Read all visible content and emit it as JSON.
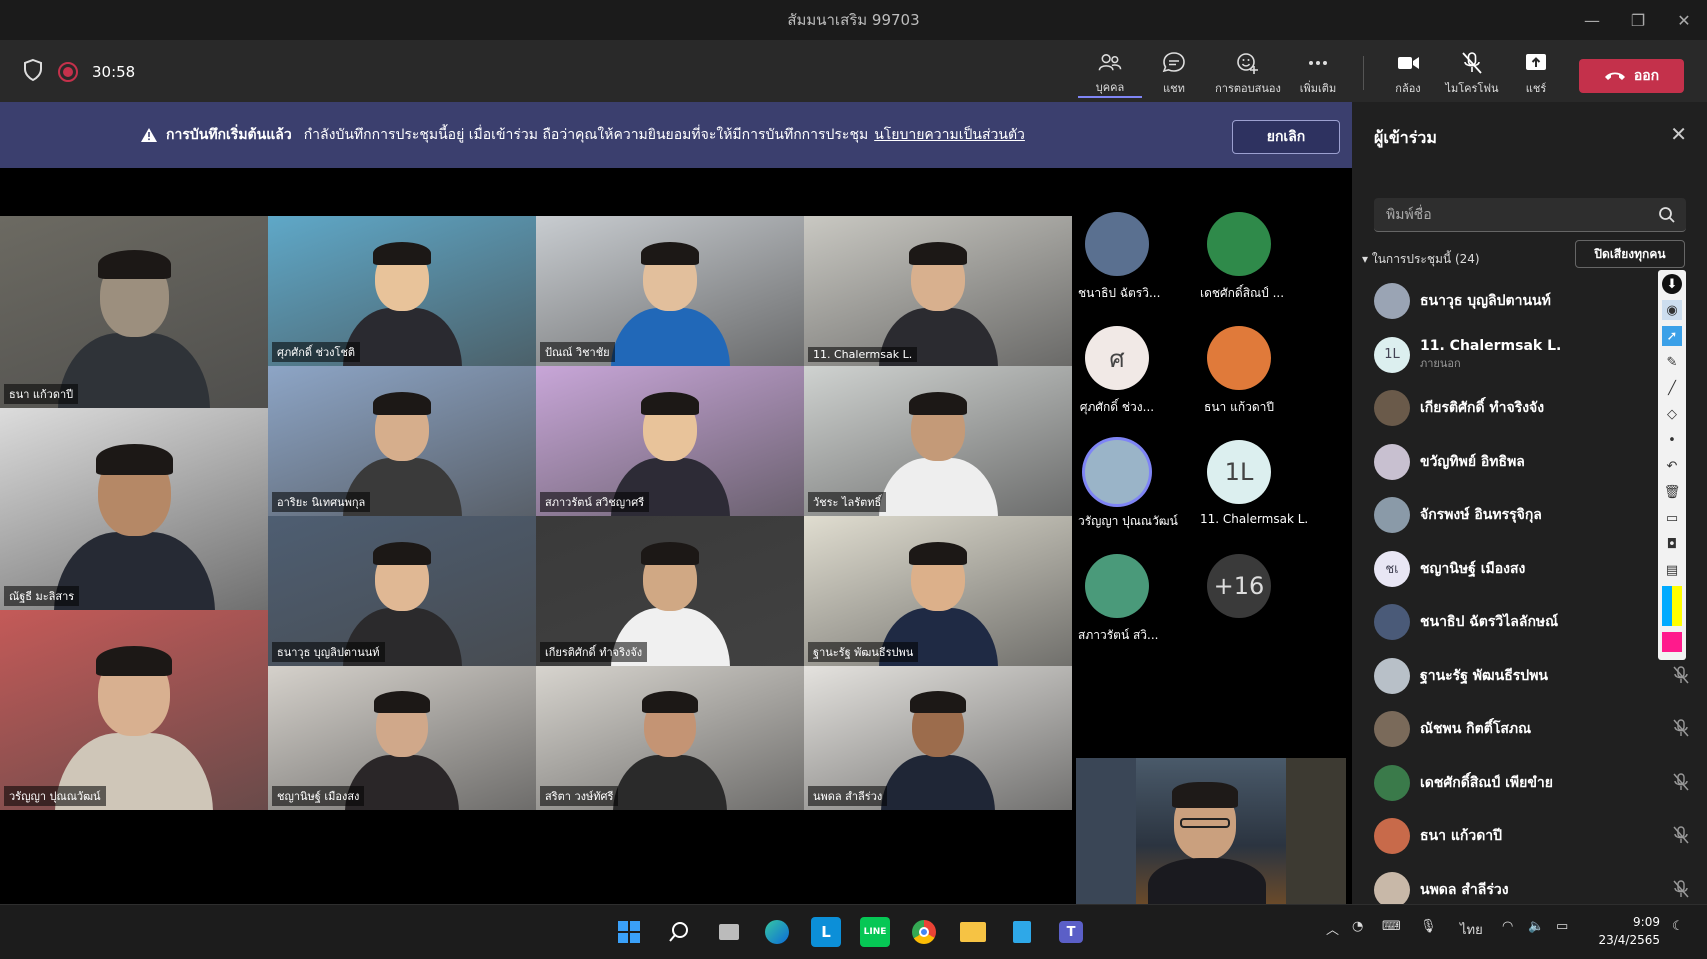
{
  "window": {
    "title": "สัมมนาเสริม 99703",
    "minimize": "—",
    "restore": "❐",
    "close": "✕"
  },
  "toolbar": {
    "timer": "30:58",
    "people_label": "บุคคล",
    "chat_label": "แชท",
    "reactions_label": "การตอบสนอง",
    "more_label": "เพิ่มเติม",
    "camera_label": "กล้อง",
    "mic_label": "ไมโครโฟน",
    "share_label": "แชร์",
    "leave_label": "ออก"
  },
  "banner": {
    "title": "การบันทึกเริ่มต้นแล้ว",
    "message": "กำลังบันทึกการประชุมนี้อยู่ เมื่อเข้าร่วม ถือว่าคุณให้ความยินยอมที่จะให้มีการบันทึกการประชุม",
    "link": "นโยบายความเป็นส่วนตัว",
    "cancel": "ยกเลิก"
  },
  "video_tiles": [
    {
      "name": "ธนา แก้วดาปี"
    },
    {
      "name": "ศุภศักดิ์ ช่วงโชติ"
    },
    {
      "name": "ปัณณ์ วิชาชัย"
    },
    {
      "name": "11. Chalermsak L."
    },
    {
      "name": "ณัฐธี มะลิสาร"
    },
    {
      "name": "อาริยะ นิเทศนพกุล"
    },
    {
      "name": "สภาวรัตน์ สวิชญาศรี"
    },
    {
      "name": "วัชระ ไลรัตทธิ์"
    },
    {
      "name": "วรัญญา ปุณณวัฒน์"
    },
    {
      "name": "ธนาวุธ บุญลิปตานนท์"
    },
    {
      "name": "เกียรติศักดิ์ ทำจริงจัง"
    },
    {
      "name": "ฐานะรัฐ พัฒนธีรปพน"
    },
    {
      "name": "ชญานิษฐ์ เมืองสง"
    },
    {
      "name": "สริตา วงษ์ทัศรี"
    },
    {
      "name": "นพดล สำลีร่วง"
    }
  ],
  "roster_avatars": [
    {
      "name": "ชนาธิป ฉัตรวิ...",
      "initials": ""
    },
    {
      "name": "เดชศักดิ์สิณป์ ...",
      "initials": ""
    },
    {
      "name": "ศุภศักดิ์ ช่วง...",
      "initials": "ศ"
    },
    {
      "name": "ธนา แก้วดาปี",
      "initials": ""
    },
    {
      "name": "วรัญญา ปุณณวัฒน์",
      "initials": ""
    },
    {
      "name": "11. Chalermsak L.",
      "initials": "1L"
    },
    {
      "name": "สภาวรัตน์ สวิ...",
      "initials": ""
    },
    {
      "name": "",
      "initials": "+16"
    }
  ],
  "panel": {
    "title": "ผู้เข้าร่วม",
    "search_placeholder": "พิมพ์ชื่อ",
    "section": "ในการประชุมนี้ (24)",
    "mute_all": "ปิดเสียงทุกคน",
    "participants": [
      {
        "name": "ธนาวุธ บุญลิปตานนท์",
        "sub": "",
        "initials": "",
        "muted": false
      },
      {
        "name": "11. Chalermsak L.",
        "sub": "ภายนอก",
        "initials": "1L",
        "muted": false
      },
      {
        "name": "เกียรติศักดิ์ ทำจริงจัง",
        "sub": "",
        "initials": "",
        "muted": false
      },
      {
        "name": "ขวัญทิพย์ อิทธิพล",
        "sub": "",
        "initials": "",
        "muted": false
      },
      {
        "name": "จักรพงษ์ อินทรรุจิกุล",
        "sub": "",
        "initials": "",
        "muted": false
      },
      {
        "name": "ชญานิษฐ์ เมืองสง",
        "sub": "",
        "initials": "ชเ",
        "muted": false
      },
      {
        "name": "ชนาธิป ฉัตรวิไลลักษณ์",
        "sub": "",
        "initials": "",
        "muted": false
      },
      {
        "name": "ฐานะรัฐ พัฒนธีรปพน",
        "sub": "",
        "initials": "",
        "muted": true
      },
      {
        "name": "ณัชพน กิตติ์โสภณ",
        "sub": "",
        "initials": "",
        "muted": true
      },
      {
        "name": "เดชศักดิ์สิณป์ เพียขำย",
        "sub": "",
        "initials": "",
        "muted": true
      },
      {
        "name": "ธนา แก้วดาปี",
        "sub": "",
        "initials": "",
        "muted": true
      },
      {
        "name": "นพดล สำลีร่วง",
        "sub": "",
        "initials": "",
        "muted": true
      }
    ]
  },
  "taskbar": {
    "language": "ไทย",
    "time": "9:09",
    "date": "23/4/2565"
  },
  "colors": {
    "accent": "#7f85f5",
    "leave": "#c4314b",
    "banner": "#3b3f6e",
    "panel": "#202020"
  }
}
